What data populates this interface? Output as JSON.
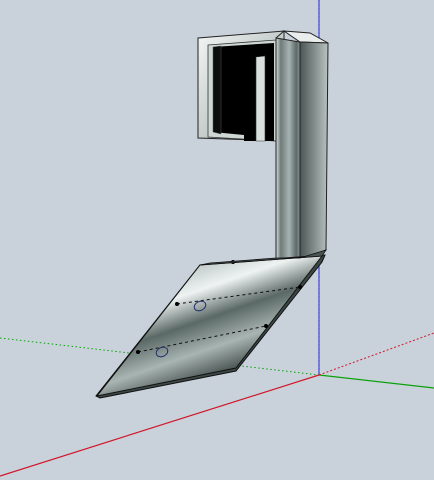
{
  "viewport": {
    "background": "#c9d2da",
    "axis_colors": {
      "red": "#d0162a",
      "green": "#0aa10a",
      "blue": "#1a1ad6"
    },
    "model": {
      "surface_dark": "#2f3a3a",
      "surface_mid": "#7c8a88",
      "surface_light": "#dfe6e4",
      "edge_color": "#111111",
      "opening_color": "#000000"
    }
  }
}
